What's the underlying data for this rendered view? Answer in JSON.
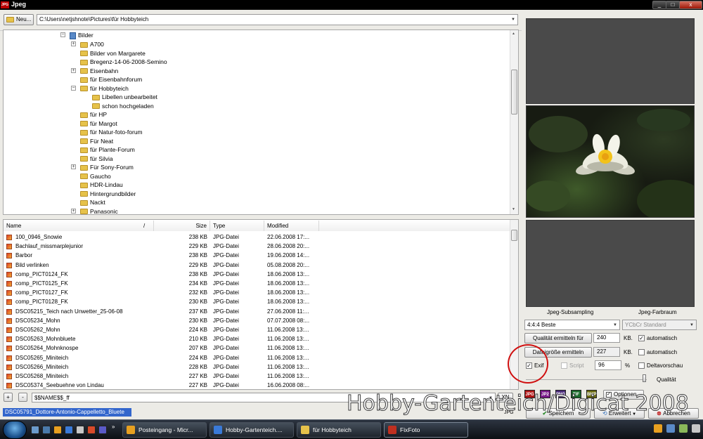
{
  "window": {
    "logo": "JPG",
    "title": "Jpeg",
    "min": "_",
    "max": "□",
    "close": "x"
  },
  "toolbar": {
    "new_label": "Neu...",
    "path": "C:\\Users\\netjshnote\\Pictures\\für Hobbyteich"
  },
  "tree": {
    "root": "Bilder",
    "items": [
      {
        "label": "A700",
        "expander": "+"
      },
      {
        "label": "Bilder von Margarete",
        "expander": ""
      },
      {
        "label": "Bregenz-14-06-2008-Semino",
        "expander": ""
      },
      {
        "label": "Eisenbahn",
        "expander": "+"
      },
      {
        "label": "für Eisenbahnforum",
        "expander": ""
      },
      {
        "label": "für Hobbyteich",
        "expander": "−"
      },
      {
        "label": "Libellen unbearbeitet",
        "expander": "",
        "child": true
      },
      {
        "label": "schon hochgeladen",
        "expander": "",
        "child": true
      },
      {
        "label": "für HP",
        "expander": ""
      },
      {
        "label": "für Margot",
        "expander": ""
      },
      {
        "label": "für Natur-foto-forum",
        "expander": ""
      },
      {
        "label": "Für Neat",
        "expander": ""
      },
      {
        "label": "für Plante-Forum",
        "expander": ""
      },
      {
        "label": "für Silvia",
        "expander": ""
      },
      {
        "label": "Für Sony-Forum",
        "expander": "+"
      },
      {
        "label": "Gaucho",
        "expander": ""
      },
      {
        "label": "HDR-Lindau",
        "expander": ""
      },
      {
        "label": "Hintergrundbilder",
        "expander": ""
      },
      {
        "label": "Nackt",
        "expander": ""
      },
      {
        "label": "Panasonic",
        "expander": "+"
      }
    ]
  },
  "list": {
    "headers": {
      "name": "Name",
      "sort": "/",
      "size": "Size",
      "type": "Type",
      "modified": "Modified"
    },
    "rows": [
      {
        "name": "100_0946_Snowie",
        "size": "238 KB",
        "type": "JPG-Datei",
        "modified": "22.06.2008 17:..."
      },
      {
        "name": "Bachlauf_missmarplejunior",
        "size": "229 KB",
        "type": "JPG-Datei",
        "modified": "28.06.2008 20:..."
      },
      {
        "name": "Barbor",
        "size": "238 KB",
        "type": "JPG-Datei",
        "modified": "19.06.2008 14:..."
      },
      {
        "name": "Bild verlinken",
        "size": "229 KB",
        "type": "JPG-Datei",
        "modified": "05.08.2008 20:..."
      },
      {
        "name": "comp_PICT0124_FK",
        "size": "238 KB",
        "type": "JPG-Datei",
        "modified": "18.06.2008 13:..."
      },
      {
        "name": "comp_PICT0125_FK",
        "size": "234 KB",
        "type": "JPG-Datei",
        "modified": "18.06.2008 13:..."
      },
      {
        "name": "comp_PICT0127_FK",
        "size": "232 KB",
        "type": "JPG-Datei",
        "modified": "18.06.2008 13:..."
      },
      {
        "name": "comp_PICT0128_FK",
        "size": "230 KB",
        "type": "JPG-Datei",
        "modified": "18.06.2008 13:..."
      },
      {
        "name": "DSC05215_Teich nach Unwetter_25-06-08",
        "size": "237 KB",
        "type": "JPG-Datei",
        "modified": "27.06.2008 11:..."
      },
      {
        "name": "DSC05234_Mohn",
        "size": "230 KB",
        "type": "JPG-Datei",
        "modified": "07.07.2008 08:..."
      },
      {
        "name": "DSC05262_Mohn",
        "size": "224 KB",
        "type": "JPG-Datei",
        "modified": "11.06.2008 13:..."
      },
      {
        "name": "DSC05263_Mohnbluete",
        "size": "210 KB",
        "type": "JPG-Datei",
        "modified": "11.06.2008 13:..."
      },
      {
        "name": "DSC05264_Mohnknospe",
        "size": "207 KB",
        "type": "JPG-Datei",
        "modified": "11.06.2008 13:..."
      },
      {
        "name": "DSC05265_Miniteich",
        "size": "224 KB",
        "type": "JPG-Datei",
        "modified": "11.06.2008 13:..."
      },
      {
        "name": "DSC05266_Miniteich",
        "size": "228 KB",
        "type": "JPG-Datei",
        "modified": "11.06.2008 13:..."
      },
      {
        "name": "DSC05268_Miniteich",
        "size": "227 KB",
        "type": "JPG-Datei",
        "modified": "11.06.2008 13:..."
      },
      {
        "name": "DSC05374_Seebuehne von Lindau",
        "size": "227 KB",
        "type": "JPG-Datei",
        "modified": "16.06.2008 08:..."
      }
    ]
  },
  "bottom": {
    "add": "+",
    "remove": "-",
    "pattern": "$$NAME$$_ff",
    "cancel_small": "XN",
    "selected_file": "DSC05791_Dottore-Antonio-Cappelletto_Bluete",
    "ext": "JPG"
  },
  "right": {
    "subsampling_label": "Jpeg-Subsampling",
    "subsampling_value": "4:4:4 Beste",
    "farbraum_label": "Jpeg-Farbraum",
    "farbraum_value": "YCbCr Standard",
    "qualitaet_button": "Qualität ermitteln für",
    "qualitaet_value": "240",
    "kb1": "KB.",
    "automatisch1": "automatisch",
    "dateigroesse_button": "Dateigröße ermitteln",
    "dateigroesse_value": "227",
    "kb2": "KB.",
    "automatisch2": "automatisch",
    "exif": "Exif",
    "script": "Script",
    "quality_value": "96",
    "percent": "%",
    "deltavorschau": "Deltavorschau",
    "qualitaet_label": "Qualität",
    "formats": [
      {
        "name": "JPG",
        "color": "#b01515"
      },
      {
        "name": "JP2",
        "color": "#7a1a8a"
      },
      {
        "name": "PNG",
        "color": "#4a2a7a"
      },
      {
        "name": "TIF",
        "color": "#1a6a2a"
      },
      {
        "name": "BMP",
        "color": "#6a6a10"
      }
    ],
    "optionen": "Optionen",
    "speichern": "Speichern",
    "erweitert": "Erweitert",
    "abbrechen": "Abbrechen"
  },
  "taskbar": {
    "items": [
      {
        "label": "Posteingang - Micr...",
        "icon_color": "#e8a020"
      },
      {
        "label": "Hobby-Gartenteich....",
        "icon_color": "#3a7ad8"
      },
      {
        "label": "für Hobbyteich",
        "icon_color": "#e6c24a"
      },
      {
        "label": "FixFoto",
        "icon_color": "#c03020"
      }
    ]
  },
  "watermark": "Hobby-Gartenteich/Digicat 2008",
  "colors": {
    "selection": "#3366cc",
    "annotation_circle": "#d01010",
    "titlebar": "#000000"
  }
}
